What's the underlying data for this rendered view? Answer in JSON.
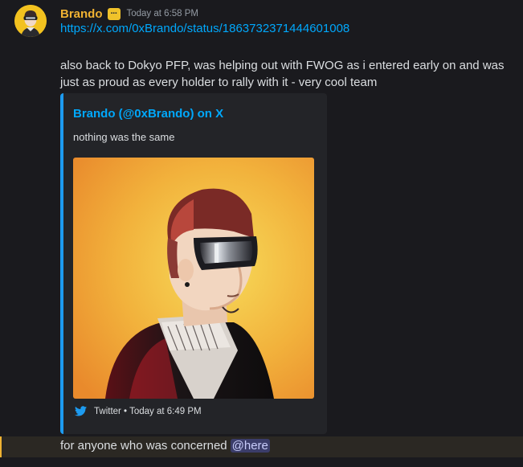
{
  "message": {
    "author": "Brando",
    "badge_icon": "ellipsis-badge-icon",
    "timestamp": "Today at 6:58 PM",
    "link": "https://x.com/0xBrando/status/1863732371444601008",
    "text": "also back to Dokyo PFP, was helping out with FWOG as i entered early on and was just as proud as every holder to rally with it - very cool team"
  },
  "embed": {
    "accent_color": "#1d9bf0",
    "author": "Brando (@0xBrando) on X",
    "description": "nothing was the same",
    "image_subject": "cartoon-pfp-avatar",
    "footer_icon": "twitter-bird-icon",
    "footer": "Twitter • Today at 6:49 PM"
  },
  "followup": {
    "text": "for anyone who was concerned",
    "mention": "@here"
  },
  "colors": {
    "username": "#f0b232",
    "link": "#00a8fc",
    "mention_bg": "#3c4270",
    "highlight_bar": "#f0b232"
  }
}
